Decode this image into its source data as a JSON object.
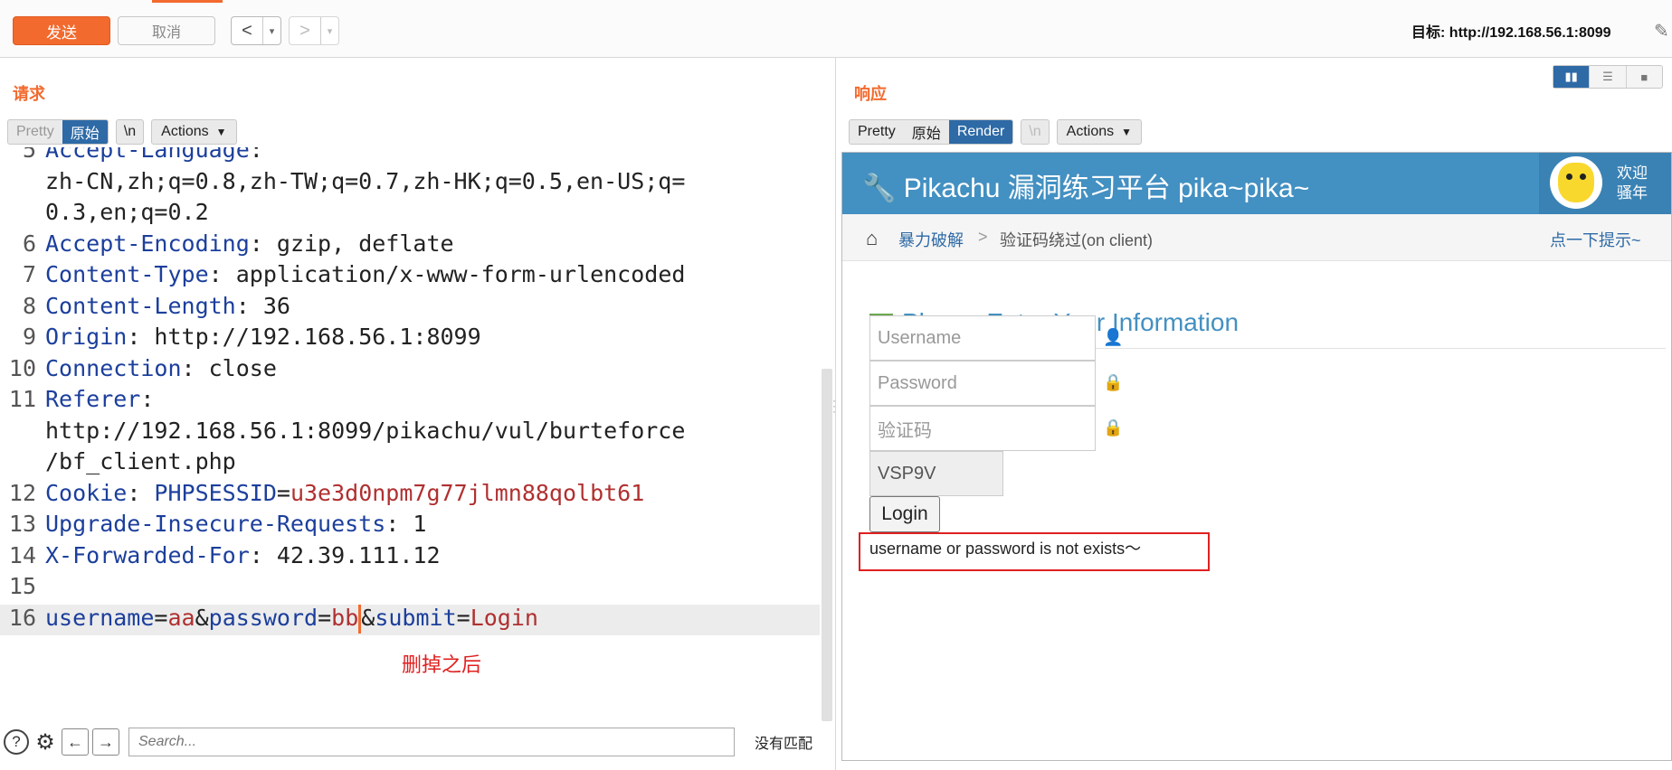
{
  "toolbar": {
    "send": "发送",
    "cancel": "取消",
    "back": "<",
    "forward": ">",
    "dropdown": "▾",
    "target_label": "目标:",
    "target_url": "http://192.168.56.1:8099"
  },
  "request": {
    "title": "请求",
    "tabs": [
      "Pretty",
      "原始"
    ],
    "newline": "\\n",
    "actions": "Actions",
    "lines": [
      {
        "n": "5",
        "key": "Accept-Language",
        "sep": ":",
        "val": ""
      },
      {
        "n": "",
        "key": "",
        "sep": "",
        "val": "zh-CN,zh;q=0.8,zh-TW;q=0.7,zh-HK;q=0.5,en-US;q="
      },
      {
        "n": "",
        "key": "",
        "sep": "",
        "val": "0.3,en;q=0.2"
      },
      {
        "n": "6",
        "key": "Accept-Encoding",
        "sep": ": ",
        "val": "gzip, deflate"
      },
      {
        "n": "7",
        "key": "Content-Type",
        "sep": ": ",
        "val": "application/x-www-form-urlencoded"
      },
      {
        "n": "8",
        "key": "Content-Length",
        "sep": ": ",
        "val": "36"
      },
      {
        "n": "9",
        "key": "Origin",
        "sep": ": ",
        "val": "http://192.168.56.1:8099"
      },
      {
        "n": "10",
        "key": "Connection",
        "sep": ": ",
        "val": "close"
      },
      {
        "n": "11",
        "key": "Referer",
        "sep": ":",
        "val": ""
      },
      {
        "n": "",
        "key": "",
        "sep": "",
        "val": "http://192.168.56.1:8099/pikachu/vul/burteforce"
      },
      {
        "n": "",
        "key": "",
        "sep": "",
        "val": "/bf_client.php"
      },
      {
        "n": "12",
        "key": "Cookie",
        "sep": ": ",
        "val": ""
      },
      {
        "n": "13",
        "key": "Upgrade-Insecure-Requests",
        "sep": ": ",
        "val": "1"
      },
      {
        "n": "14",
        "key": "X-Forwarded-For",
        "sep": ": ",
        "val": "42.39.111.12"
      },
      {
        "n": "15",
        "key": "",
        "sep": "",
        "val": ""
      }
    ],
    "cookie": {
      "name": "PHPSESSID",
      "eq": "=",
      "value": "u3e3d0npm7g77jlmn88qolbt61"
    },
    "body": {
      "n": "16",
      "k1": "username",
      "eq1": "=",
      "v1": "aa",
      "amp1": "&",
      "k2": "password",
      "eq2": "=",
      "v2": "bb",
      "amp2": "&",
      "k3": "submit",
      "eq3": "=",
      "v3": "Login"
    },
    "annotation": "删掉之后"
  },
  "search": {
    "placeholder": "Search...",
    "status": "没有匹配"
  },
  "response": {
    "title": "响应",
    "tabs": [
      "Pretty",
      "原始",
      "Render"
    ],
    "newline": "\\n",
    "actions": "Actions"
  },
  "page": {
    "brand": "Pikachu 漏洞练习平台 pika~pika~",
    "welcome_1": "欢迎",
    "welcome_2": "骚年",
    "crumb_1": "暴力破解",
    "crumb_sep": ">",
    "crumb_2": "验证码绕过(on client)",
    "hint": "点一下提示~",
    "form_title": "Please Enter Your Information",
    "username_ph": "Username",
    "password_ph": "Password",
    "captcha_ph": "验证码",
    "captcha_value": "VSP9V",
    "login": "Login",
    "message": "username or password is not exists～"
  },
  "colors": {
    "accent": "#f26a2e",
    "selected": "#2e6aa6",
    "header": "#4390c2",
    "key": "#1c3f9c",
    "value": "#b03030",
    "highlight": "#e02020"
  }
}
